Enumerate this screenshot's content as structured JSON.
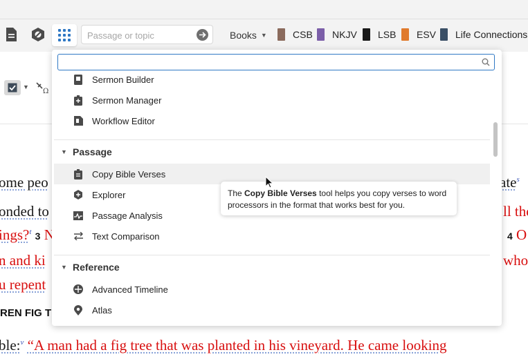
{
  "toolbar": {
    "search_placeholder": "Passage or topic",
    "books_label": "Books",
    "shortcuts": [
      {
        "label": "CSB",
        "color": "#8a6a5c"
      },
      {
        "label": "NKJV",
        "color": "#7b5ea8"
      },
      {
        "label": "LSB",
        "color": "#1a1a1a"
      },
      {
        "label": "ESV",
        "color": "#e07a2c"
      },
      {
        "label": "Life Connections S",
        "color": "#3a4f66"
      }
    ]
  },
  "bible_text": {
    "line1_left": "ome peo",
    "line1_right": "ate",
    "line1_sup": "s",
    "line2_left": "onded to",
    "line2_right": "ll the",
    "line3_left": "ings?",
    "line3_sup": "t",
    "line3_vnum": "3",
    "line3_mid": "N",
    "line3_right_vnum": "4",
    "line3_right": "O",
    "line4_left": "n and ki",
    "line4_right": "who",
    "line5_left": "u repent",
    "heading": "REN FIG TR",
    "last_line_prefix": "ble:",
    "last_line_sup": "v",
    "last_line": "“A man had a fig tree that was planted in his vineyard. He came looking"
  },
  "dropdown": {
    "filter_placeholder": "",
    "items_top": [
      {
        "label": "Sermon Builder",
        "icon": "sermon-builder-icon"
      },
      {
        "label": "Sermon Manager",
        "icon": "sermon-manager-icon"
      },
      {
        "label": "Workflow Editor",
        "icon": "workflow-editor-icon"
      }
    ],
    "passage": {
      "title": "Passage",
      "items": [
        {
          "label": "Copy Bible Verses",
          "icon": "copy-verses-icon"
        },
        {
          "label": "Explorer",
          "icon": "explorer-icon"
        },
        {
          "label": "Passage Analysis",
          "icon": "passage-analysis-icon"
        },
        {
          "label": "Text Comparison",
          "icon": "text-comparison-icon"
        }
      ]
    },
    "reference": {
      "title": "Reference",
      "items": [
        {
          "label": "Advanced Timeline",
          "icon": "timeline-icon"
        },
        {
          "label": "Atlas",
          "icon": "atlas-icon"
        }
      ]
    }
  },
  "tooltip": {
    "prefix": "The ",
    "tool_name": "Copy Bible Verses",
    "suffix_line1": " tool helps you copy verses to word",
    "line2": "processors in the format that works best for you."
  },
  "colors": {
    "accent": "#2f78c4",
    "words_of_christ": "#d80f0f",
    "icon_dark": "#4a4a4a"
  }
}
